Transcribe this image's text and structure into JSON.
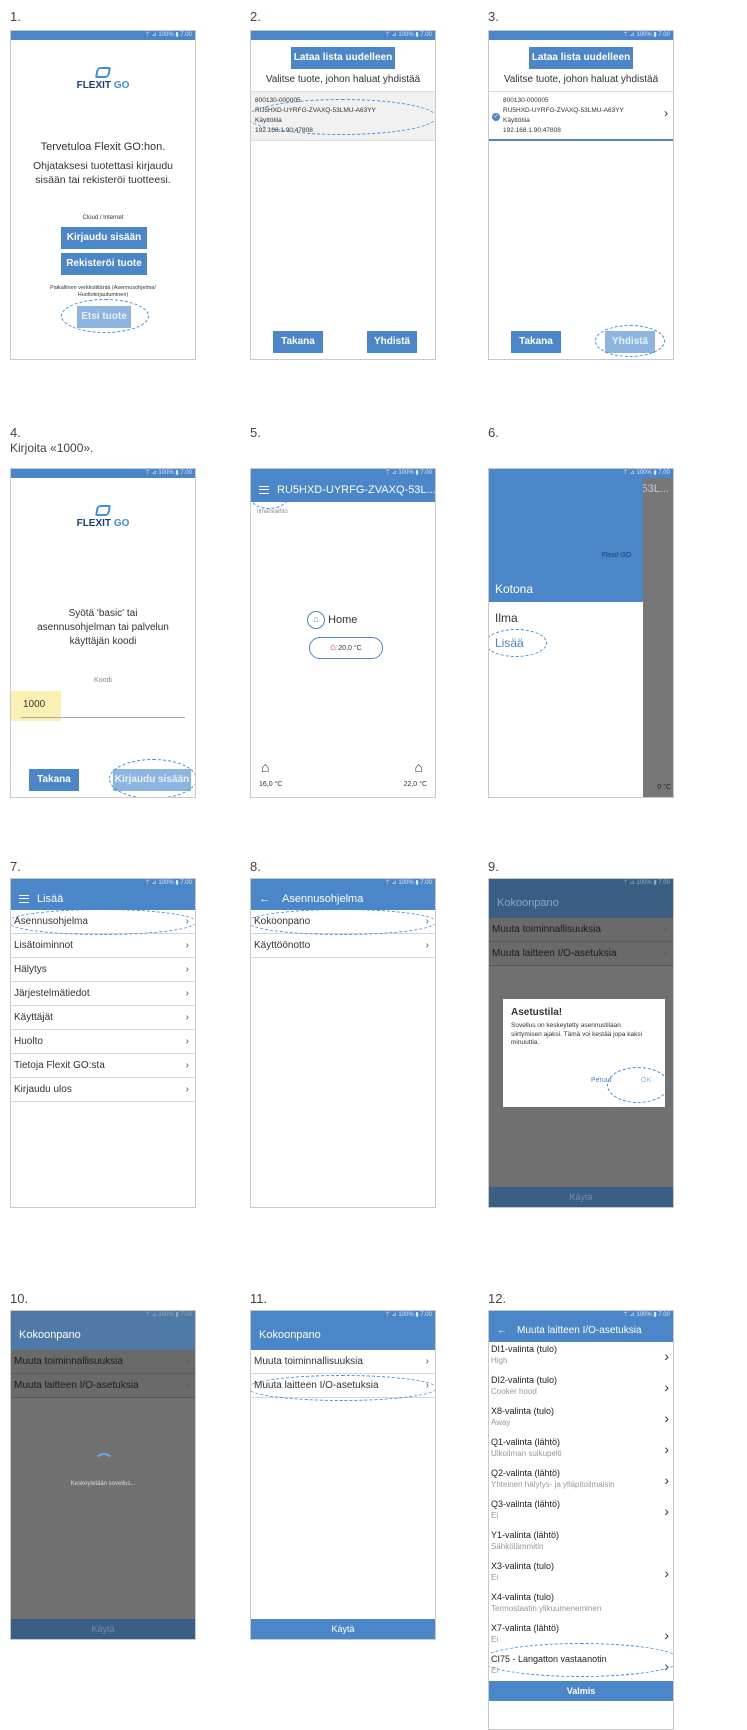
{
  "steps": {
    "s1": {
      "num": "1.",
      "status": "⇡ ⊿ 100% ▮ 7.00",
      "brand": "FLEXIT",
      "brand_go": "GO",
      "welcome": "Tervetuloa Flexit GO:hon.",
      "instr": "Ohjataksesi tuotettasi kirjaudu sisään tai rekisteröi tuotteesi.",
      "cloud": "Cloud / Internet",
      "login": "Kirjaudu sisään",
      "register": "Rekisteröi tuote",
      "local": "Paikallinen verkkoliitäntä (Asennusohjelma/ Huoltokirjautuminen)",
      "find": "Etsi tuote"
    },
    "s2": {
      "num": "2.",
      "status": "⇡ ⊿ 100% ▮ 7.00",
      "reload": "Lataa lista uudelleen",
      "choose": "Valitse tuote, johon haluat yhdistää",
      "item_l1": "800130-000005",
      "item_l2": "RU5HXD-UYRFG-ZVAXQ-53LMU-A63YY",
      "item_l3": "Käyttötila",
      "item_l4": "192.168.1.90:47808",
      "back": "Takana",
      "connect": "Yhdistä"
    },
    "s3": {
      "num": "3.",
      "status": "⇡ ⊿ 100% ▮ 7.00",
      "reload": "Lataa lista uudelleen",
      "choose": "Valitse tuote, johon haluat yhdistää",
      "item_l1": "800130-000005",
      "item_l2": "RU5HXD-UYRFG-ZVAXQ-53LMU-A63YY",
      "item_l3": "Käyttötila",
      "item_l4": "192.168.1.90:47808",
      "back": "Takana",
      "connect": "Yhdistä"
    },
    "s4": {
      "num": "4.",
      "note": "Kirjoita «1000».",
      "status": "⇡ ⊿ 100% ▮ 7.00",
      "brand": "FLEXIT",
      "brand_go": "GO",
      "prompt": "Syötä 'basic' tai asennusohjelman tai palvelun käyttäjän koodi",
      "code_label": "Koodi",
      "code_value": "1000",
      "back": "Takana",
      "login": "Kirjaudu sisään"
    },
    "s5": {
      "num": "5.",
      "status": "⇡ ⊿ 100% ▮ 7.00",
      "title": "RU5HXD-UYRFG-ZVAXQ-53L...",
      "sub": "Ilmanvaihto",
      "home": "Home",
      "temp_main": "20,0 °C",
      "temp_left": "16,0 °C",
      "temp_right": "22,0 °C"
    },
    "s6": {
      "num": "6.",
      "status": "⇡ ⊿ 100% ▮ 7.00",
      "drawer_brand": "Flexit GO",
      "home": "Kotona",
      "item1": "Ilma",
      "item2": "Lisää",
      "peek_title": "53L...",
      "peek_temp": "0 °C"
    },
    "s7": {
      "num": "7.",
      "status": "⇡ ⊿ 100% ▮ 7.00",
      "title": "Lisää",
      "items": [
        "Asennusohjelma",
        "Lisätoiminnot",
        "Hälytys",
        "Järjestelmätiedot",
        "Käyttäjät",
        "Huolto",
        "Tietoja Flexit GO:sta",
        "Kirjaudu ulos"
      ]
    },
    "s8": {
      "num": "8.",
      "status": "⇡ ⊿ 100% ▮ 7.00",
      "title": "Asennusohjelma",
      "items": [
        "Kokoonpano",
        "Käyttöönotto"
      ]
    },
    "s9": {
      "num": "9.",
      "status": "⇡ ⊿ 100% ▮ 7.00",
      "title": "Kokoonpano",
      "items": [
        "Muuta toiminnallisuuksia",
        "Muuta laitteen I/O-asetuksia"
      ],
      "dlg_title": "Asetustila!",
      "dlg_body": "Sovellus on keskeytetty asennustilaan siirtymisen ajaksi. Tämä voi kestää jopa kaksi minuuttia.",
      "cancel": "Peruut",
      "ok": "OK",
      "apply": "Käytä"
    },
    "s10": {
      "num": "10.",
      "status": "⇡ ⊿ 100% ▮ 7.00",
      "title": "Kokoonpano",
      "items": [
        "Muuta toiminnallisuuksia",
        "Muuta laitteen I/O-asetuksia"
      ],
      "loading": "Keskeytetään sovellus...",
      "apply": "Käytä"
    },
    "s11": {
      "num": "11.",
      "status": "⇡ ⊿ 100% ▮ 7.00",
      "title": "Kokoonpano",
      "items": [
        "Muuta toiminnallisuuksia",
        "Muuta laitteen I/O-asetuksia"
      ],
      "apply": "Käytä"
    },
    "s12": {
      "num": "12.",
      "status": "⇡ ⊿ 100% ▮ 7.00",
      "title": "Muuta laitteen I/O-asetuksia",
      "rows": [
        {
          "t": "DI1-valinta (tulo)",
          "v": "High"
        },
        {
          "t": "DI2-valinta (tulo)",
          "v": "Cooker hood"
        },
        {
          "t": "X8-valinta (tulo)",
          "v": "Away"
        },
        {
          "t": "Q1-valinta (lähtö)",
          "v": "Ulkoilman sulkupelti"
        },
        {
          "t": "Q2-valinta (lähtö)",
          "v": "Yhteinen hälytys- ja ylläpitoilmaisin"
        },
        {
          "t": "Q3-valinta (lähtö)",
          "v": "Ei"
        },
        {
          "t": "Y1-valinta (lähtö)",
          "v": "Sähkölämmitin"
        },
        {
          "t": "X3-valinta (tulo)",
          "v": "Ei"
        },
        {
          "t": "X4-valinta (tulo)",
          "v": "Termostaatin ylikuumeneminen"
        },
        {
          "t": "X7-valinta (lähtö)",
          "v": "Ei"
        },
        {
          "t": "CI75 - Langatton vastaanotin",
          "v": "Ei"
        }
      ],
      "done": "Valmis"
    }
  }
}
